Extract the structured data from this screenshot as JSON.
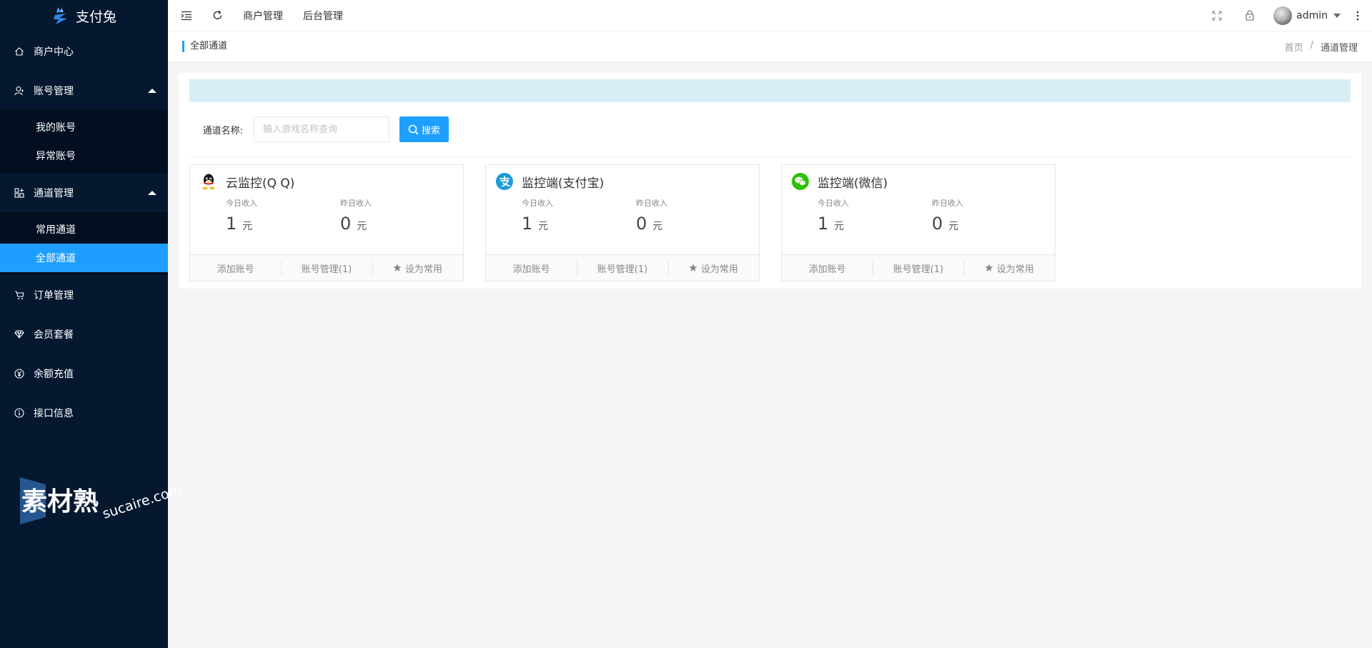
{
  "app": {
    "name": "支付兔"
  },
  "sidebar": {
    "home": {
      "label": "商户中心",
      "icon": "home-icon"
    },
    "account_group": {
      "label": "账号管理",
      "icon": "user-icon",
      "items": [
        {
          "label": "我的账号"
        },
        {
          "label": "异常账号"
        }
      ]
    },
    "channel_group": {
      "label": "通道管理",
      "icon": "apps-icon",
      "items": [
        {
          "label": "常用通道"
        },
        {
          "label": "全部通道",
          "active": true
        }
      ]
    },
    "orders": {
      "label": "订单管理",
      "icon": "cart-icon"
    },
    "membership": {
      "label": "会员套餐",
      "icon": "diamond-icon"
    },
    "recharge": {
      "label": "余额充值",
      "icon": "yen-icon"
    },
    "api": {
      "label": "接口信息",
      "icon": "info-icon"
    }
  },
  "header": {
    "nav": [
      {
        "label": "商户管理"
      },
      {
        "label": "后台管理"
      }
    ],
    "user": {
      "name": "admin"
    }
  },
  "watermark": {
    "text_cn": "素材熟",
    "text_en": "sucaire.com"
  },
  "breadcrumb": {
    "title": "全部通道",
    "home": "首页",
    "separator": "/",
    "current": "通道管理"
  },
  "search": {
    "label": "通道名称:",
    "placeholder": "输入游戏名称查询",
    "value": "",
    "button": "搜索"
  },
  "channels": [
    {
      "title": "云监控(Q Q)",
      "icon": "qq-icon",
      "today_label": "今日收入",
      "today_value": "1",
      "today_unit": "元",
      "yesterday_label": "昨日收入",
      "yesterday_value": "0",
      "yesterday_unit": "元",
      "actions": {
        "add": "添加账号",
        "manage": "账号管理(1)",
        "favorite": "设为常用"
      }
    },
    {
      "title": "监控端(支付宝)",
      "icon": "alipay-icon",
      "today_label": "今日收入",
      "today_value": "1",
      "today_unit": "元",
      "yesterday_label": "昨日收入",
      "yesterday_value": "0",
      "yesterday_unit": "元",
      "actions": {
        "add": "添加账号",
        "manage": "账号管理(1)",
        "favorite": "设为常用"
      }
    },
    {
      "title": "监控端(微信)",
      "icon": "wechat-icon",
      "today_label": "今日收入",
      "today_value": "1",
      "today_unit": "元",
      "yesterday_label": "昨日收入",
      "yesterday_value": "0",
      "yesterday_unit": "元",
      "actions": {
        "add": "添加账号",
        "manage": "账号管理(1)",
        "favorite": "设为常用"
      }
    }
  ],
  "colors": {
    "sidebar_bg": "#051830",
    "accent": "#1e9fff",
    "notice_bg": "#d9edf7"
  }
}
